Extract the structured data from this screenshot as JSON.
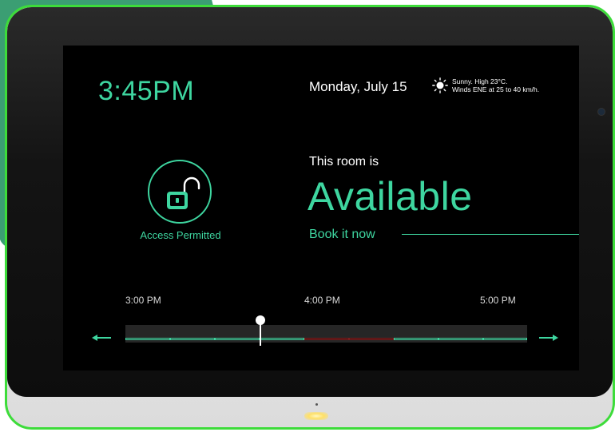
{
  "clock": {
    "time": "3:45PM"
  },
  "header": {
    "date": "Monday, July 15",
    "weather_line1": "Sunny. High 23°C.",
    "weather_line2": "Winds ENE at 25 to 40 km/h.",
    "weather_icon": "sun-icon"
  },
  "access": {
    "label": "Access Permitted",
    "icon": "unlock-icon"
  },
  "room": {
    "intro": "This room is",
    "status": "Available",
    "book_label": "Book it now"
  },
  "timeline": {
    "labels": [
      "3:00 PM",
      "4:00 PM",
      "5:00 PM"
    ],
    "current_time_marker": "3:45 PM",
    "busy_range": [
      "4:00 PM",
      "4:30 PM"
    ]
  },
  "colors": {
    "accent": "#3ed6a0",
    "busy": "#7a1f1f",
    "frame": "#3ddc3a",
    "screen": "#000000"
  }
}
